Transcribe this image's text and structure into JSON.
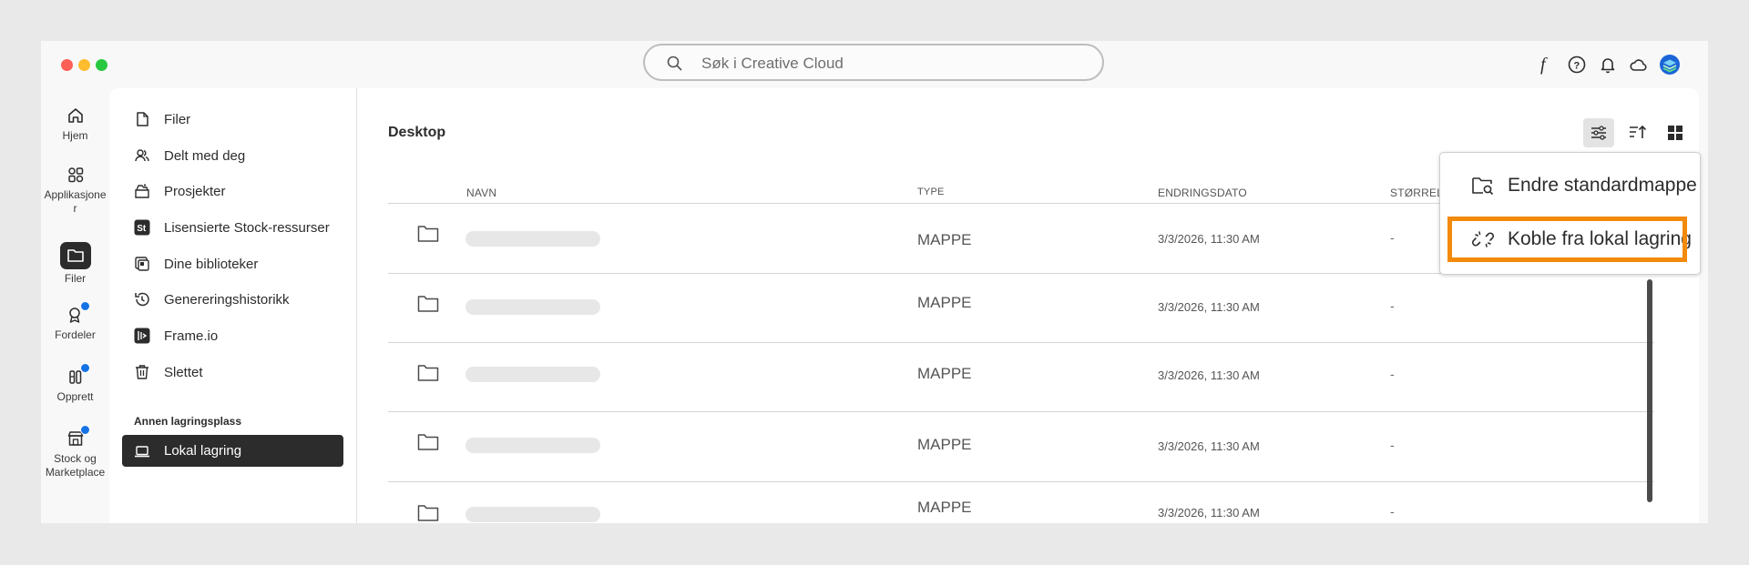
{
  "search": {
    "placeholder": "Søk i Creative Cloud"
  },
  "topbar": {
    "icons": [
      "fonts-icon",
      "help-icon",
      "bell-icon",
      "cloud-icon",
      "account-avatar"
    ]
  },
  "rail": {
    "items": [
      {
        "label": "Hjem",
        "icon": "home-icon"
      },
      {
        "label": "Applikasjone r",
        "icon": "apps-icon"
      },
      {
        "label": "Filer",
        "icon": "folder-icon"
      },
      {
        "label": "Fordeler",
        "icon": "badge-icon"
      },
      {
        "label": "Opprett",
        "icon": "create-icon"
      },
      {
        "label": "Stock og Marketplace",
        "icon": "stock-icon"
      }
    ]
  },
  "sidebar": {
    "items": [
      {
        "label": "Filer",
        "icon": "file-icon"
      },
      {
        "label": "Delt med deg",
        "icon": "people-icon"
      },
      {
        "label": "Prosjekter",
        "icon": "projects-icon"
      },
      {
        "label": "Lisensierte Stock-ressurser",
        "icon": "stock-st-icon"
      },
      {
        "label": "Dine biblioteker",
        "icon": "library-icon"
      },
      {
        "label": "Genereringshistorikk",
        "icon": "history-icon"
      },
      {
        "label": "Frame.io",
        "icon": "frameio-icon"
      },
      {
        "label": "Slettet",
        "icon": "trash-icon"
      }
    ],
    "section_label": "Annen lagringsplass",
    "active_item": "Lokal lagring"
  },
  "content": {
    "breadcrumb": "Desktop",
    "columns": {
      "name": "NAVN",
      "type": "TYPE",
      "date": "ENDRINGSDATO",
      "size": "STØRRELSE"
    },
    "rows": [
      {
        "type": "MAPPE",
        "date": "3/3/2026, 11:30 AM",
        "size": "-"
      },
      {
        "type": "MAPPE",
        "date": "3/3/2026, 11:30 AM",
        "size": "-"
      },
      {
        "type": "MAPPE",
        "date": "3/3/2026, 11:30 AM",
        "size": "-"
      },
      {
        "type": "MAPPE",
        "date": "3/3/2026, 11:30 AM",
        "size": "-"
      },
      {
        "type": "MAPPE",
        "date": "3/3/2026, 11:30 AM",
        "size": "-"
      }
    ]
  },
  "menu": {
    "items": [
      {
        "label": "Endre standardmappe",
        "icon": "folder-search-icon"
      },
      {
        "label": "Koble fra lokal lagring",
        "icon": "unlink-icon"
      }
    ],
    "highlight_color": "#f28a0b"
  },
  "colors": {
    "accent_dot": "#1473e6",
    "active_bg": "#2c2c2c",
    "traffic": [
      "#fe5f57",
      "#febc2e",
      "#28c840"
    ]
  }
}
